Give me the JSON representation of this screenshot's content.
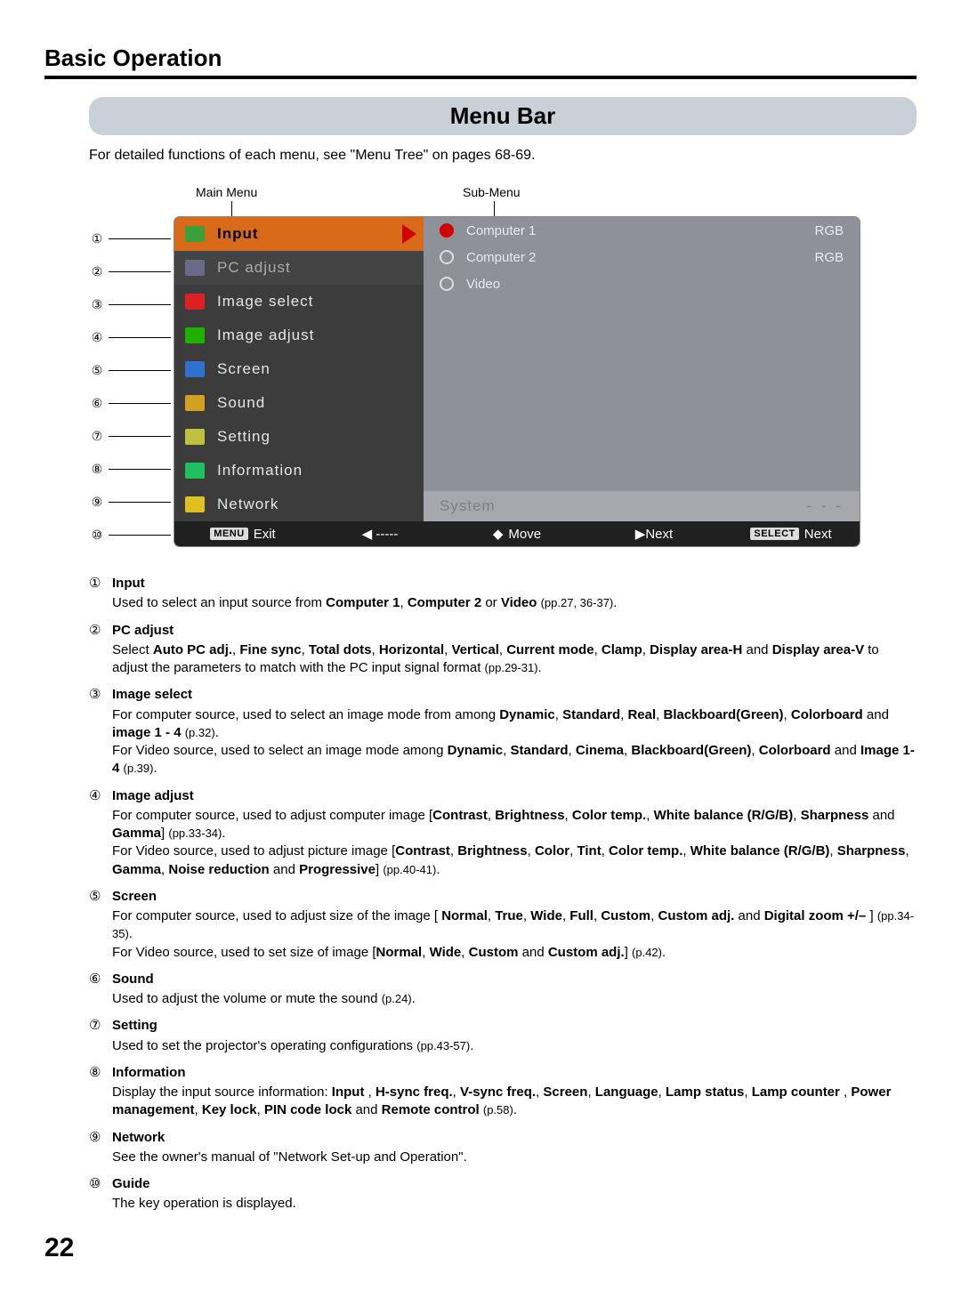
{
  "header": "Basic Operation",
  "title": "Menu Bar",
  "intro": "For detailed functions of each menu, see \"Menu Tree\" on pages 68-69.",
  "labels": {
    "main": "Main Menu",
    "sub": "Sub-Menu"
  },
  "callouts": [
    "①",
    "②",
    "③",
    "④",
    "⑤",
    "⑥",
    "⑦",
    "⑧",
    "⑨",
    "⑩"
  ],
  "menu": {
    "items": [
      {
        "label": "Input",
        "selected": true
      },
      {
        "label": "PC adjust",
        "dim": true
      },
      {
        "label": "Image select"
      },
      {
        "label": "Image adjust"
      },
      {
        "label": "Screen"
      },
      {
        "label": "Sound"
      },
      {
        "label": "Setting"
      },
      {
        "label": "Information"
      },
      {
        "label": "Network"
      }
    ],
    "sub": [
      {
        "label": "Computer 1",
        "right": "RGB",
        "filled": true
      },
      {
        "label": "Computer 2",
        "right": "RGB",
        "filled": false
      },
      {
        "label": "Video",
        "right": "",
        "filled": false
      }
    ],
    "system": {
      "label": "System",
      "right": "- - -"
    },
    "guide": {
      "exit_btn": "MENU",
      "exit": "Exit",
      "back": "◀ -----",
      "move": "Move",
      "next": "▶Next",
      "select_btn": "SELECT",
      "select": "Next"
    }
  },
  "desc": [
    {
      "num": "①",
      "title": "Input",
      "body": "Used to select an input source from <b>Computer 1</b>, <b>Computer 2</b> or <b>Video</b> <span class='smallref'>(pp.27, 36-37)</span>."
    },
    {
      "num": "②",
      "title": "PC adjust",
      "body": "Select <b>Auto PC adj.</b>, <b>Fine sync</b>, <b>Total dots</b>, <b>Horizontal</b>, <b>Vertical</b>, <b>Current mode</b>, <b>Clamp</b>, <b>Display area-H</b> and <b>Display area-V</b> to adjust the parameters to match with the PC input signal format <span class='smallref'>(pp.29-31)</span>."
    },
    {
      "num": "③",
      "title": "Image select",
      "body": "For computer source, used to select an image mode from among <b>Dynamic</b>, <b>Standard</b>, <b>Real</b>, <b>Blackboard(Green)</b>, <b>Colorboard</b> and <b>image 1 - 4</b> <span class='smallref'>(p.32)</span>.<br>For Video source, used to select an image mode among <b>Dynamic</b>, <b>Standard</b>, <b>Cinema</b>, <b>Blackboard(Green)</b>, <b>Colorboard</b> and <b>Image 1- 4</b> <span class='smallref'>(p.39)</span>."
    },
    {
      "num": "④",
      "title": "Image adjust",
      "body": "For computer source, used to adjust computer image [<b>Contrast</b>, <b>Brightness</b>, <b>Color temp.</b>, <b>White balance (R/G/B)</b>, <b>Sharpness</b> and <b>Gamma</b>] <span class='smallref'>(pp.33-34)</span>.<br>For Video source, used to adjust picture image [<b>Contrast</b>, <b>Brightness</b>, <b>Color</b>, <b>Tint</b>, <b>Color temp.</b>, <b>White balance (R/G/B)</b>, <b>Sharpness</b>, <b>Gamma</b>, <b>Noise reduction</b> and <b>Progressive</b>] <span class='smallref'>(pp.40-41)</span>."
    },
    {
      "num": "⑤",
      "title": "Screen",
      "body": "For computer source, used to adjust size of the image [ <b>Normal</b>, <b>True</b>, <b>Wide</b>, <b>Full</b>, <b>Custom</b>, <b>Custom adj.</b> and <b>Digital zoom +/–</b> ] <span class='smallref'>(pp.34-35)</span>.<br>For Video source, used to set size of image [<b>Normal</b>, <b>Wide</b>, <b>Custom</b> and <b>Custom adj.</b>] <span class='smallref'>(p.42)</span>."
    },
    {
      "num": "⑥",
      "title": "Sound",
      "body": "Used to adjust the volume or mute the sound <span class='smallref'>(p.24)</span>."
    },
    {
      "num": "⑦",
      "title": "Setting",
      "body": "Used to set the projector's operating configurations <span class='smallref'>(pp.43-57)</span>."
    },
    {
      "num": "⑧",
      "title": "Information",
      "body": "Display the input source information: <b>Input</b> , <b>H-sync freq.</b>, <b>V-sync freq.</b>, <b>Screen</b>, <b>Language</b>, <b>Lamp status</b>, <b>Lamp counter</b> , <b>Power management</b>, <b>Key lock</b>, <b>PIN code lock</b> and <b>Remote control</b> <span class='smallref'>(p.58)</span>."
    },
    {
      "num": "⑨",
      "title": "Network",
      "body": "See the owner's manual of \"Network Set-up and Operation\"."
    },
    {
      "num": "⑩",
      "title": "Guide",
      "body": "The key operation is displayed."
    }
  ],
  "page_number": "22"
}
